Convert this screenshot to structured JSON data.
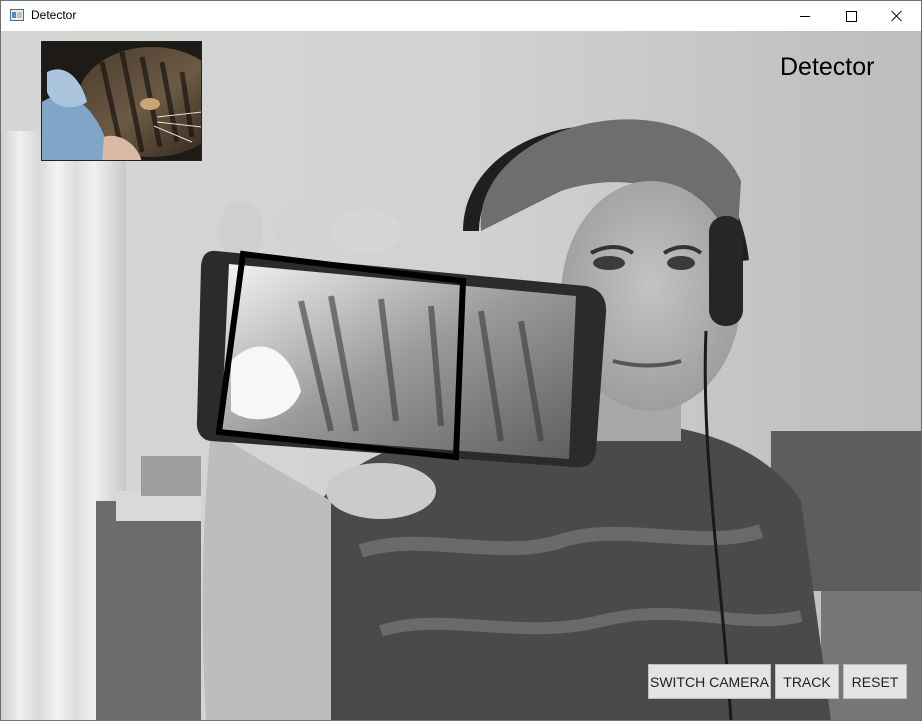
{
  "window": {
    "title": "Detector",
    "icon": "app-window-icon",
    "controls": [
      "minimize-icon",
      "maximize-icon",
      "close-icon"
    ]
  },
  "overlay": {
    "title": "Detector"
  },
  "thumbnail": {
    "icon": "reference-cat-image"
  },
  "video": {
    "icon": "camera-feed",
    "detection_box": "detected-object-outline"
  },
  "buttons": {
    "switch_camera": "SWITCH CAMERA",
    "track": "TRACK",
    "reset": "RESET"
  }
}
